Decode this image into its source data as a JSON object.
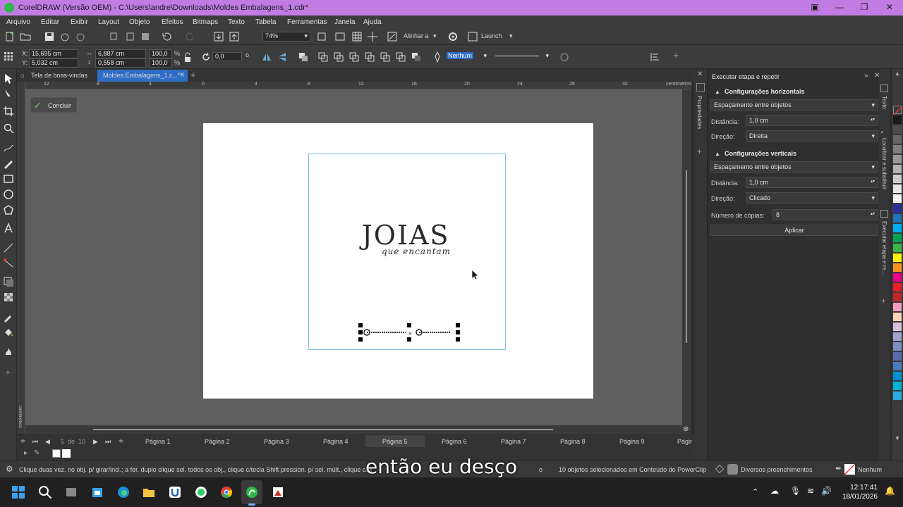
{
  "window": {
    "title": "CorelDRAW (Versão OEM) - C:\\Users\\andre\\Downloads\\Moldes Embalagens_1.cdr*",
    "minimize": "—",
    "maximize": "❐",
    "close": "✕"
  },
  "menu": [
    "Arquivo",
    "Editar",
    "Exibir",
    "Layout",
    "Objeto",
    "Efeitos",
    "Bitmaps",
    "Texto",
    "Tabela",
    "Ferramentas",
    "Janela",
    "Ajuda"
  ],
  "toolbar1": {
    "zoom": "74%",
    "align_label": "Alinhar a",
    "launch_label": "Launch"
  },
  "toolbar2": {
    "x": "15,695 cm",
    "y": "5,032 cm",
    "width": "6,887 cm",
    "height": "0,558 cm",
    "scale_w": "100,0",
    "scale_h": "100,0",
    "pct": "%",
    "x_label": "X:",
    "y_label": "Y:",
    "angle": "0,0",
    "degree": "o",
    "fill": "Nenhum"
  },
  "tabs": {
    "welcome": "Tela de boas-vindas",
    "document": "Moldes Embalagens_1.c...*",
    "add": "+"
  },
  "ruler": {
    "unit": "centímetros",
    "ticks": [
      "12",
      "8",
      "4",
      "0",
      "4",
      "8",
      "12",
      "16",
      "20",
      "24",
      "28",
      "32",
      "36"
    ]
  },
  "canvas": {
    "done_label": "Concluir",
    "logo_main": "JOIAS",
    "logo_sub": "que encantam"
  },
  "pages": {
    "current": "5",
    "of": "de",
    "total": "10",
    "list": [
      "Página 1",
      "Página 2",
      "Página 3",
      "Página 4",
      "Página 5",
      "Página 6",
      "Página 7",
      "Página 8",
      "Página 9",
      "Págir"
    ]
  },
  "panel": {
    "title": "Executar etapa e repetir",
    "horizontal": {
      "title": "Configurações horizontais",
      "mode": "Espaçamento entre objetos",
      "distance_label": "Distância:",
      "distance": "1,0 cm",
      "direction_label": "Direção:",
      "direction": "Direita"
    },
    "vertical": {
      "title": "Configurações verticais",
      "mode": "Espaçamento entre objetos",
      "distance_label": "Distância:",
      "distance": "1,0 cm",
      "direction_label": "Direção:",
      "direction": "Clicado"
    },
    "copies_label": "Número de cópias:",
    "copies": "8",
    "apply": "Aplicar",
    "dock_left": "Propriedades",
    "dock_right": [
      "Texto",
      "Localizar e substituir",
      "Executar etapa e re..."
    ]
  },
  "status": {
    "hint": "Clique duas vez. no obj. p/ girar/incl.; a fer. duplo clique sel. todos os obj., clique c/tecla Shift pression. p/ sel. múlt., clique c/te",
    "hint_tail": "o",
    "selection": "10 objetos selecionados em Conteúdo do PowerClip",
    "fill_info": "Diversos preenchimentos",
    "outline_info": "Nenhum",
    "caption": "então eu desço"
  },
  "clock": {
    "time": "12:17:41",
    "date": "18/01/2026"
  },
  "palette_colors": [
    "#ffffff",
    "#1a1a1a",
    "#4d4d4d",
    "#666666",
    "#808080",
    "#999999",
    "#b3b3b3",
    "#cccccc",
    "#e6e6e6",
    "#f2f2f2",
    "#2b2f9a",
    "#1b75bc",
    "#00aeef",
    "#00a651",
    "#39b54a",
    "#fff200",
    "#f7941d",
    "#ec008c",
    "#ed1c24",
    "#c1272d",
    "#f49ac1",
    "#fbd5b5",
    "#d7c0de",
    "#a3a0d0",
    "#7b8fc7",
    "#5b6ba9",
    "#4a7bbf",
    "#0091d5",
    "#00b3d8",
    "#29abe2"
  ]
}
